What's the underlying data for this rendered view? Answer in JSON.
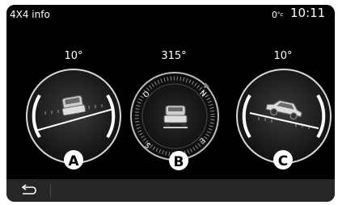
{
  "app": {
    "title": "4X4 info"
  },
  "status": {
    "temperature": "0",
    "temperature_unit": "°c",
    "clock": "10:11"
  },
  "gauges": [
    {
      "id": "pitch",
      "marker": "A",
      "value": "10°",
      "reading_degrees": 10
    },
    {
      "id": "compass",
      "marker": "B",
      "value": "315°",
      "reading_degrees": 315,
      "cardinals": {
        "north": "N",
        "east": "E",
        "south": "S",
        "west": "O"
      }
    },
    {
      "id": "roll",
      "marker": "C",
      "value": "10°",
      "reading_degrees": 10
    }
  ],
  "icons": {
    "back": "back-arrow-icon"
  },
  "colors": {
    "background": "#000000",
    "text": "#ffffff",
    "bottom_bar": "#262626",
    "accent_marker": "#9a9a9a"
  }
}
